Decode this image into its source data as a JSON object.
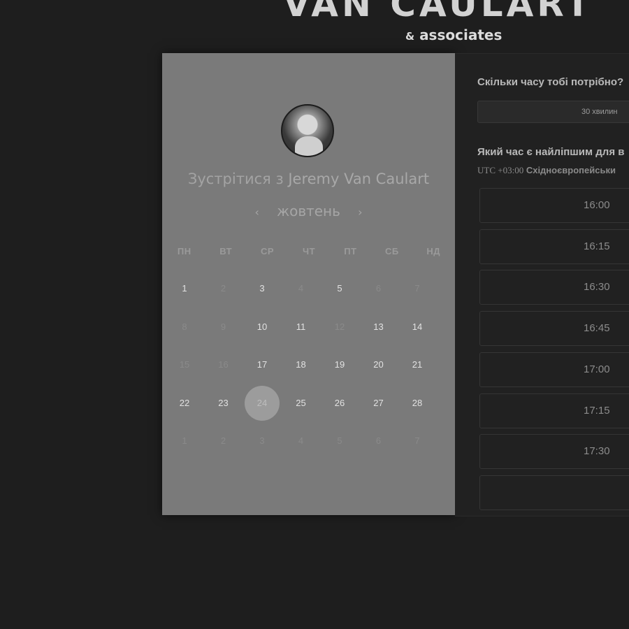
{
  "brand": {
    "title": "VAN CAULART",
    "amp": "&",
    "subtitle": "associates"
  },
  "booking": {
    "meet_prefix": "Зустрітися з",
    "host_name": "Jeremy Van Caulart",
    "month": "жовтень",
    "prev_icon": "‹",
    "next_icon": "›"
  },
  "weekdays": [
    "ПН",
    "ВТ",
    "СР",
    "ЧТ",
    "ПТ",
    "СБ",
    "НД"
  ],
  "calendar": [
    [
      {
        "d": "1",
        "s": "active"
      },
      {
        "d": "2",
        "s": "inactive"
      },
      {
        "d": "3",
        "s": "active"
      },
      {
        "d": "4",
        "s": "inactive"
      },
      {
        "d": "5",
        "s": "active"
      },
      {
        "d": "6",
        "s": "inactive"
      },
      {
        "d": "7",
        "s": "inactive"
      }
    ],
    [
      {
        "d": "8",
        "s": "inactive"
      },
      {
        "d": "9",
        "s": "inactive"
      },
      {
        "d": "10",
        "s": "active"
      },
      {
        "d": "11",
        "s": "active"
      },
      {
        "d": "12",
        "s": "inactive"
      },
      {
        "d": "13",
        "s": "active"
      },
      {
        "d": "14",
        "s": "active"
      }
    ],
    [
      {
        "d": "15",
        "s": "inactive"
      },
      {
        "d": "16",
        "s": "inactive"
      },
      {
        "d": "17",
        "s": "active"
      },
      {
        "d": "18",
        "s": "active"
      },
      {
        "d": "19",
        "s": "active"
      },
      {
        "d": "20",
        "s": "active"
      },
      {
        "d": "21",
        "s": "active"
      }
    ],
    [
      {
        "d": "22",
        "s": "active"
      },
      {
        "d": "23",
        "s": "active"
      },
      {
        "d": "24",
        "s": "selected"
      },
      {
        "d": "25",
        "s": "active"
      },
      {
        "d": "26",
        "s": "active"
      },
      {
        "d": "27",
        "s": "active"
      },
      {
        "d": "28",
        "s": "active"
      }
    ],
    [
      {
        "d": "1",
        "s": "inactive"
      },
      {
        "d": "2",
        "s": "inactive"
      },
      {
        "d": "3",
        "s": "inactive"
      },
      {
        "d": "4",
        "s": "inactive"
      },
      {
        "d": "5",
        "s": "inactive"
      },
      {
        "d": "6",
        "s": "inactive"
      },
      {
        "d": "7",
        "s": "inactive"
      }
    ]
  ],
  "right": {
    "duration_question": "Скільки часу тобі потрібно?",
    "duration_value": "30 хвилин",
    "time_question": "Який час є найліпшим для в",
    "tz_offset": "UTC +03:00",
    "tz_name": "Східноєвропейськи",
    "slots": [
      "16:00",
      "16:15",
      "16:30",
      "16:45",
      "17:00",
      "17:15",
      "17:30"
    ]
  },
  "colors": {
    "background": "#1e1e1e",
    "panel_left": "#7a7a7a",
    "panel_right": "#212121",
    "selected_day": "#9c9c9c"
  }
}
